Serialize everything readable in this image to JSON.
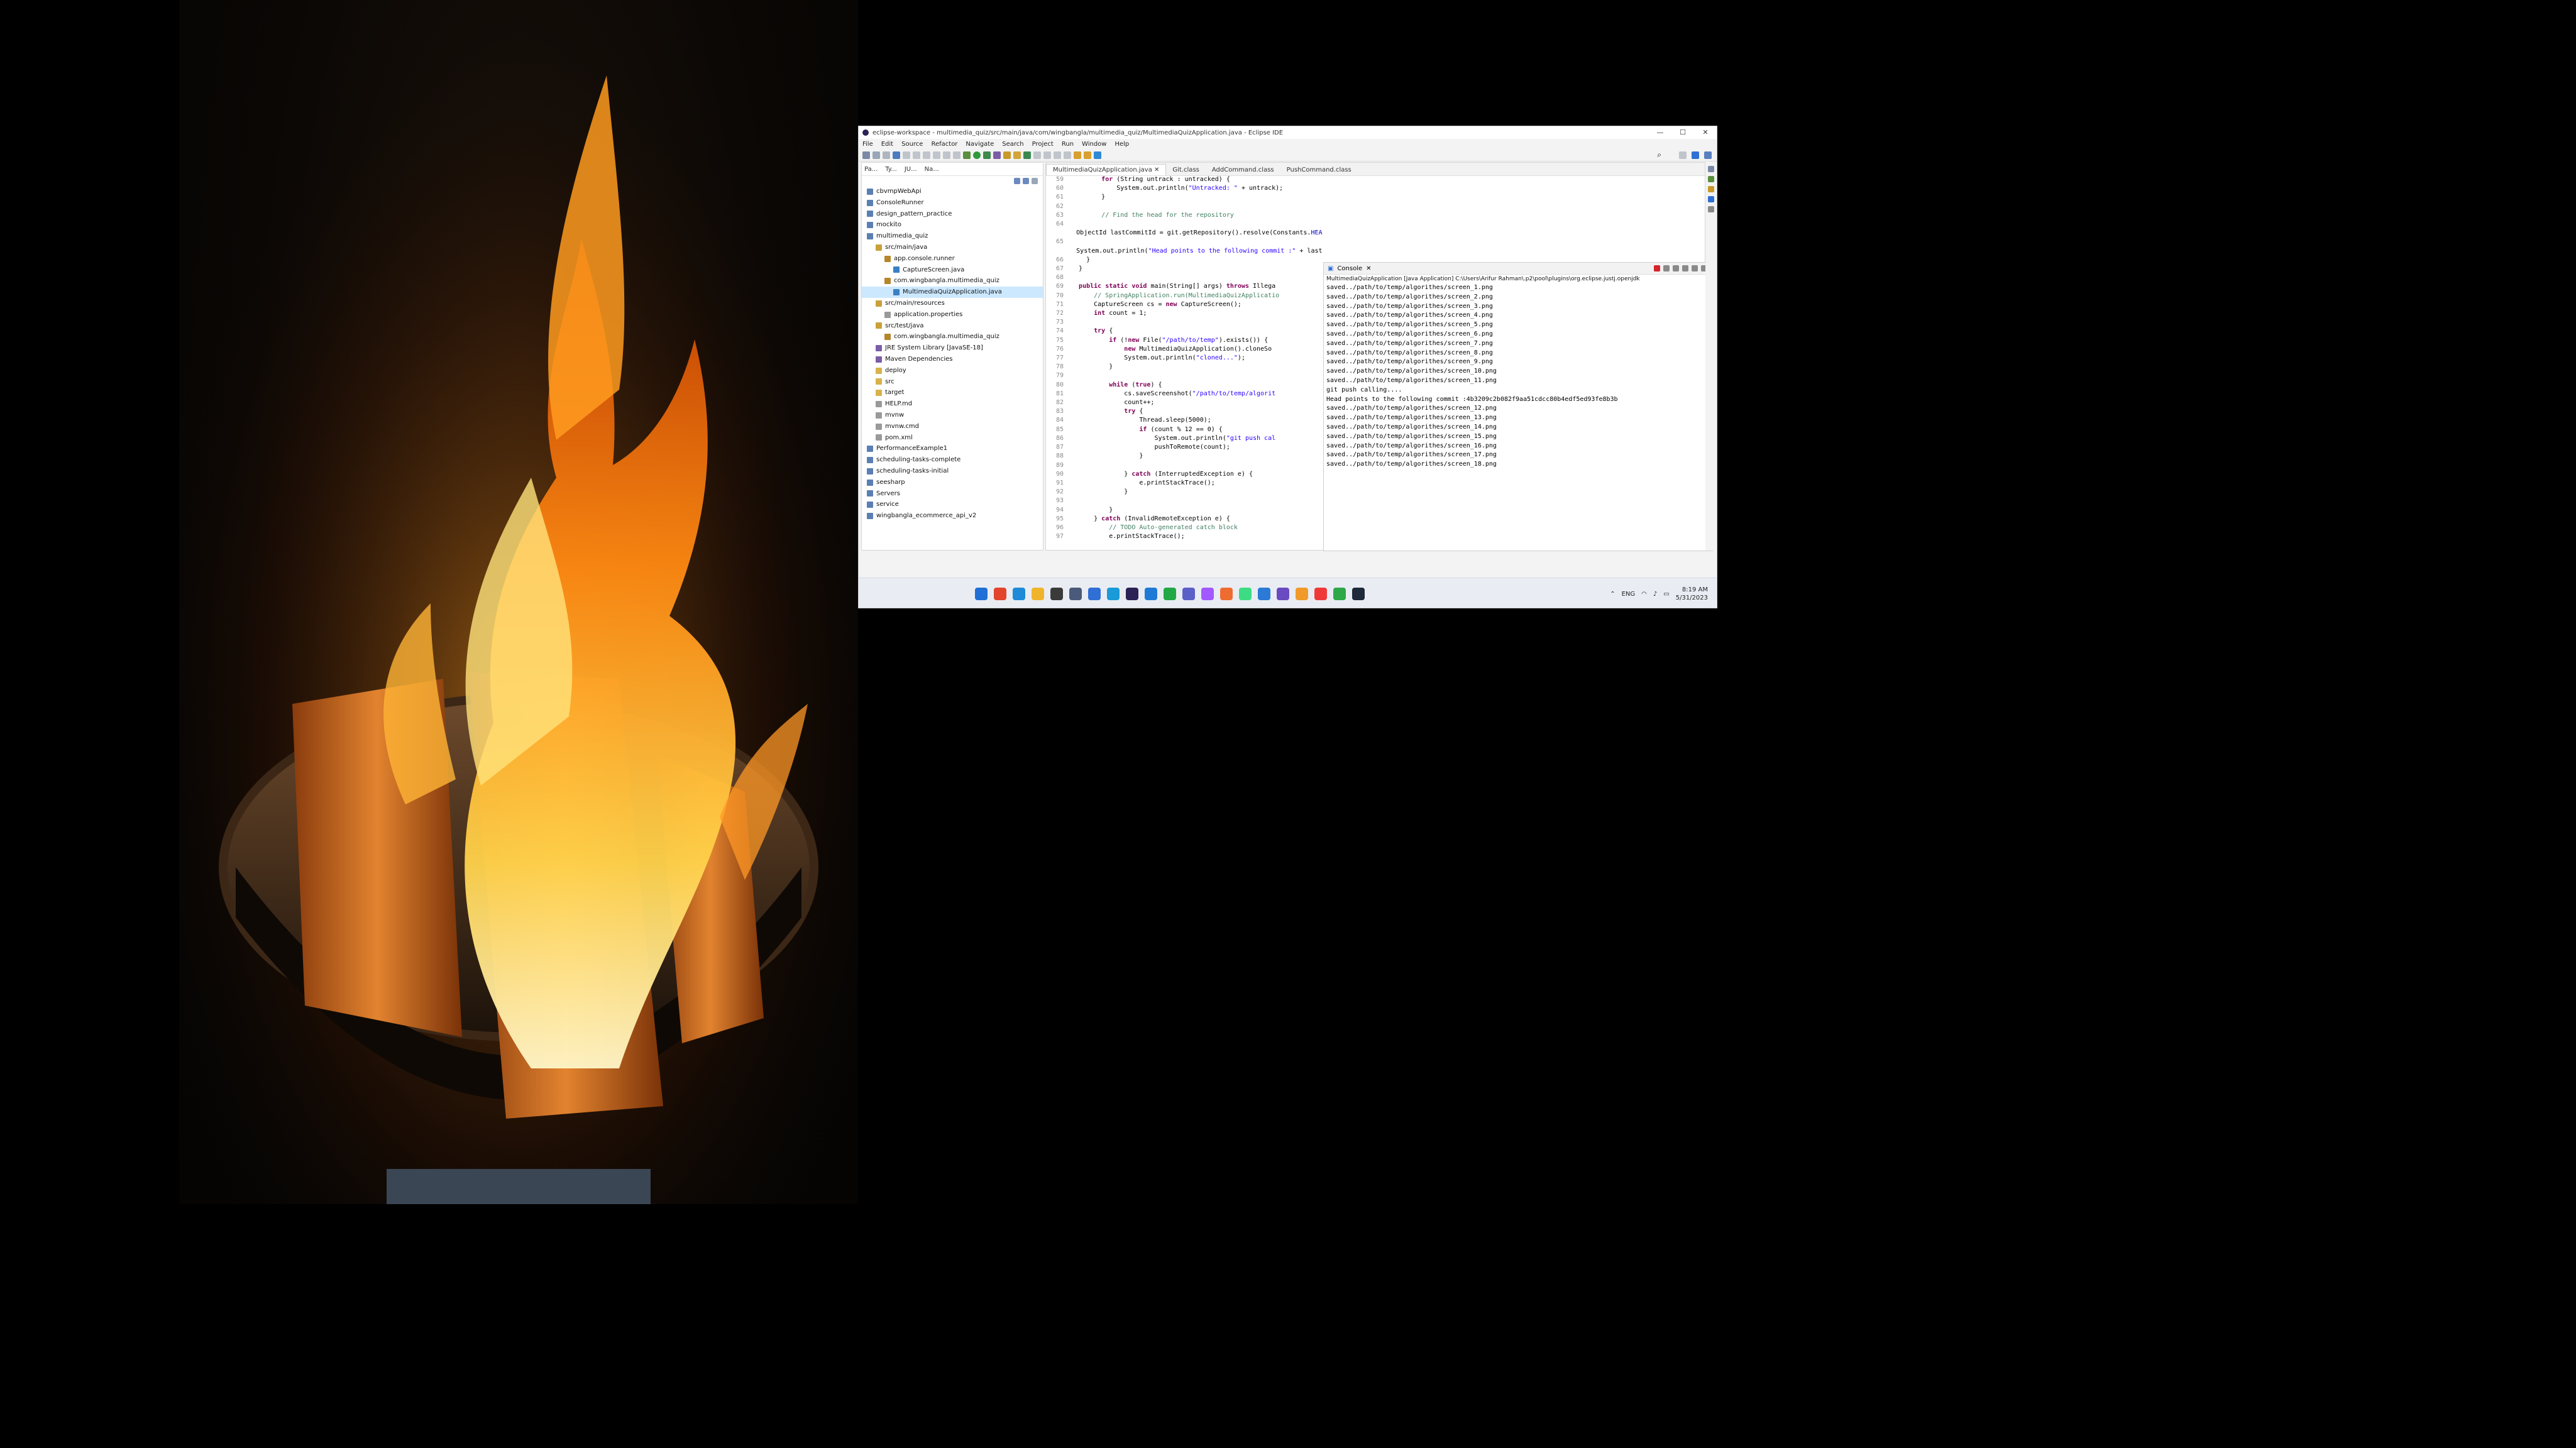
{
  "window": {
    "title": "eclipse-workspace - multimedia_quiz/src/main/java/com/wingbangla/multimedia_quiz/MultimediaQuizApplication.java - Eclipse IDE",
    "controls": [
      "—",
      "☐",
      "✕"
    ]
  },
  "menu": [
    "File",
    "Edit",
    "Source",
    "Refactor",
    "Navigate",
    "Search",
    "Project",
    "Run",
    "Window",
    "Help"
  ],
  "left_panel": {
    "tabs": [
      "Pa...",
      "Ty...",
      "JU...",
      "Na..."
    ],
    "tree": [
      {
        "label": "cbvmpWebApi",
        "depth": 0,
        "icon": "project-icon"
      },
      {
        "label": "ConsoleRunner",
        "depth": 0,
        "icon": "project-icon"
      },
      {
        "label": "design_pattern_practice",
        "depth": 0,
        "icon": "project-icon"
      },
      {
        "label": "mockito",
        "depth": 0,
        "icon": "project-icon"
      },
      {
        "label": "multimedia_quiz",
        "depth": 0,
        "icon": "project-icon"
      },
      {
        "label": "src/main/java",
        "depth": 1,
        "icon": "source-folder-icon"
      },
      {
        "label": "app.console.runner",
        "depth": 2,
        "icon": "package-icon"
      },
      {
        "label": "CaptureScreen.java",
        "depth": 3,
        "icon": "java-file-icon"
      },
      {
        "label": "com.wingbangla.multimedia_quiz",
        "depth": 2,
        "icon": "package-icon"
      },
      {
        "label": "MultimediaQuizApplication.java",
        "depth": 3,
        "icon": "java-file-icon",
        "selected": true
      },
      {
        "label": "src/main/resources",
        "depth": 1,
        "icon": "source-folder-icon"
      },
      {
        "label": "application.properties",
        "depth": 2,
        "icon": "file-icon"
      },
      {
        "label": "src/test/java",
        "depth": 1,
        "icon": "source-folder-icon"
      },
      {
        "label": "com.wingbangla.multimedia_quiz",
        "depth": 2,
        "icon": "package-icon"
      },
      {
        "label": "JRE System Library [JavaSE-18]",
        "depth": 1,
        "icon": "library-icon"
      },
      {
        "label": "Maven Dependencies",
        "depth": 1,
        "icon": "library-icon"
      },
      {
        "label": "deploy",
        "depth": 1,
        "icon": "folder-icon"
      },
      {
        "label": "src",
        "depth": 1,
        "icon": "folder-icon"
      },
      {
        "label": "target",
        "depth": 1,
        "icon": "folder-icon"
      },
      {
        "label": "HELP.md",
        "depth": 1,
        "icon": "file-icon"
      },
      {
        "label": "mvnw",
        "depth": 1,
        "icon": "file-icon"
      },
      {
        "label": "mvnw.cmd",
        "depth": 1,
        "icon": "file-icon"
      },
      {
        "label": "pom.xml",
        "depth": 1,
        "icon": "file-icon"
      },
      {
        "label": "PerformanceExample1",
        "depth": 0,
        "icon": "project-icon"
      },
      {
        "label": "scheduling-tasks-complete",
        "depth": 0,
        "icon": "project-icon"
      },
      {
        "label": "scheduling-tasks-initial",
        "depth": 0,
        "icon": "project-icon"
      },
      {
        "label": "seesharp",
        "depth": 0,
        "icon": "project-icon"
      },
      {
        "label": "Servers",
        "depth": 0,
        "icon": "project-icon"
      },
      {
        "label": "service",
        "depth": 0,
        "icon": "project-icon"
      },
      {
        "label": "wingbangla_ecommerce_api_v2",
        "depth": 0,
        "icon": "project-icon"
      }
    ]
  },
  "editor": {
    "tabs": [
      "MultimediaQuizApplication.java",
      "Git.class",
      "AddCommand.class",
      "PushCommand.class"
    ],
    "lines": [
      {
        "n": "59",
        "t": "        for (String untrack : untracked) {"
      },
      {
        "n": "60",
        "t": "            System.out.println(\"Untracked: \" + untrack);"
      },
      {
        "n": "61",
        "t": "        }"
      },
      {
        "n": "62",
        "t": ""
      },
      {
        "n": "63",
        "t": "        // Find the head for the repository"
      },
      {
        "n": "64",
        "t": "        ObjectId lastCommitId = git.getRepository().resolve(Constants.HEAD);"
      },
      {
        "n": "65",
        "t": "        System.out.println(\"Head points to the following commit :\" + lastCommitId.getName());"
      },
      {
        "n": "66",
        "t": "    }"
      },
      {
        "n": "67",
        "t": "  }"
      },
      {
        "n": "68",
        "t": ""
      },
      {
        "n": "69",
        "t": "  public static void main(String[] args) throws Illega"
      },
      {
        "n": "70",
        "t": "      // SpringApplication.run(MultimediaQuizApplicatio"
      },
      {
        "n": "71",
        "t": "      CaptureScreen cs = new CaptureScreen();"
      },
      {
        "n": "72",
        "t": "      int count = 1;"
      },
      {
        "n": "73",
        "t": ""
      },
      {
        "n": "74",
        "t": "      try {"
      },
      {
        "n": "75",
        "t": "          if (!new File(\"/path/to/temp\").exists()) {"
      },
      {
        "n": "76",
        "t": "              new MultimediaQuizApplication().cloneSo"
      },
      {
        "n": "77",
        "t": "              System.out.println(\"cloned...\");"
      },
      {
        "n": "78",
        "t": "          }"
      },
      {
        "n": "79",
        "t": ""
      },
      {
        "n": "80",
        "t": "          while (true) {"
      },
      {
        "n": "81",
        "t": "              cs.saveScreenshot(\"/path/to/temp/algorit"
      },
      {
        "n": "82",
        "t": "              count++;"
      },
      {
        "n": "83",
        "t": "              try {"
      },
      {
        "n": "84",
        "t": "                  Thread.sleep(5000);"
      },
      {
        "n": "85",
        "t": "                  if (count % 12 == 0) {"
      },
      {
        "n": "86",
        "t": "                      System.out.println(\"git push cal"
      },
      {
        "n": "87",
        "t": "                      pushToRemote(count);"
      },
      {
        "n": "88",
        "t": "                  }"
      },
      {
        "n": "89",
        "t": ""
      },
      {
        "n": "90",
        "t": "              } catch (InterruptedException e) {"
      },
      {
        "n": "91",
        "t": "                  e.printStackTrace();"
      },
      {
        "n": "92",
        "t": "              }"
      },
      {
        "n": "93",
        "t": ""
      },
      {
        "n": "94",
        "t": "          }"
      },
      {
        "n": "95",
        "t": "      } catch (InvalidRemoteException e) {"
      },
      {
        "n": "96",
        "t": "          // TODO Auto-generated catch block"
      },
      {
        "n": "97",
        "t": "          e.printStackTrace();"
      }
    ]
  },
  "console": {
    "tab": "Console",
    "description": "MultimediaQuizApplication [Java Application] C:\\Users\\Arifur Rahman\\.p2\\pool\\plugins\\org.eclipse.justj.openjdk",
    "lines": [
      "saved../path/to/temp/algorithes/screen_1.png",
      "saved../path/to/temp/algorithes/screen_2.png",
      "saved../path/to/temp/algorithes/screen_3.png",
      "saved../path/to/temp/algorithes/screen_4.png",
      "saved../path/to/temp/algorithes/screen_5.png",
      "saved../path/to/temp/algorithes/screen_6.png",
      "saved../path/to/temp/algorithes/screen_7.png",
      "saved../path/to/temp/algorithes/screen_8.png",
      "saved../path/to/temp/algorithes/screen_9.png",
      "saved../path/to/temp/algorithes/screen_10.png",
      "saved../path/to/temp/algorithes/screen_11.png",
      "git push calling....",
      "Head points to the following commit :4b3209c2b082f9aa51cdcc80b4edf5ed93fe8b3b",
      "saved../path/to/temp/algorithes/screen_12.png",
      "saved../path/to/temp/algorithes/screen_13.png",
      "saved../path/to/temp/algorithes/screen_14.png",
      "saved../path/to/temp/algorithes/screen_15.png",
      "saved../path/to/temp/algorithes/screen_16.png",
      "saved../path/to/temp/algorithes/screen_17.png",
      "saved../path/to/temp/algorithes/screen_18.png"
    ]
  },
  "taskbar": {
    "icons": [
      "windows-start-icon",
      "brave-icon",
      "edge-icon",
      "file-explorer-icon",
      "terminal-icon",
      "calculator-icon",
      "security-icon",
      "skype-icon",
      "eclipse-icon",
      "vscode-icon",
      "whatsapp-icon",
      "teams-icon",
      "figma-icon",
      "postman-icon",
      "android-icon",
      "notepad-icon",
      "snipping-icon",
      "sublime-icon",
      "vivaldi-icon",
      "chrome-icon",
      "powershell-icon"
    ],
    "language": "ENG",
    "time": "8:19 AM",
    "date": "5/31/2023"
  },
  "colors": {
    "keyword": "#7f0055",
    "comment": "#3f7f5f",
    "string": "#2a00ff",
    "selection": "#cce8ff",
    "taskbar": "#e9edf3"
  }
}
